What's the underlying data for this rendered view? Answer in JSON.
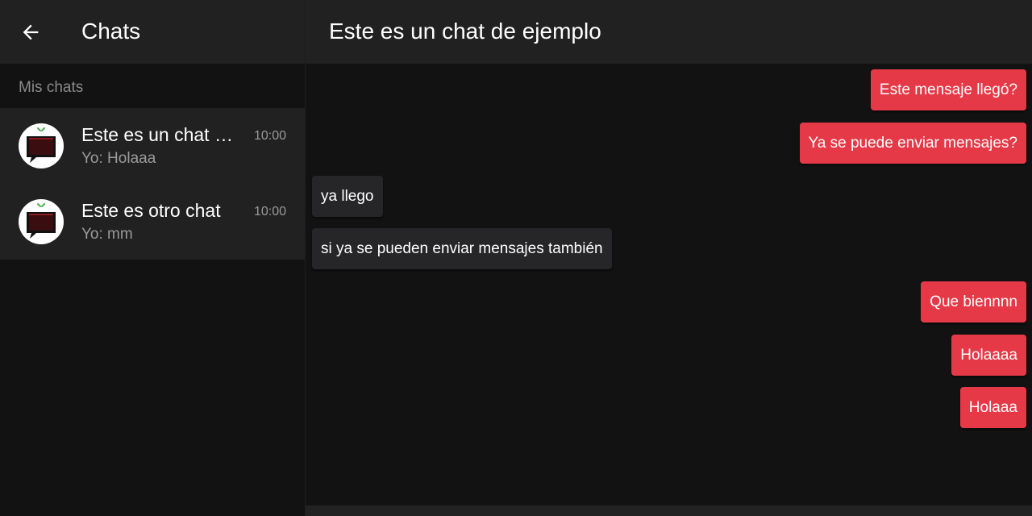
{
  "sidebar": {
    "title": "Chats",
    "section_label": "Mis chats",
    "chats": [
      {
        "name": "Este es un chat de ejemplo",
        "preview": "Yo: Holaaa",
        "time": "10:00"
      },
      {
        "name": "Este es otro chat",
        "preview": "Yo: mm",
        "time": "10:00"
      }
    ]
  },
  "main": {
    "title": "Este es un chat de ejemplo",
    "messages": [
      {
        "text": "Este mensaje llegó?",
        "direction": "sent"
      },
      {
        "text": "Ya se puede enviar mensajes?",
        "direction": "sent"
      },
      {
        "text": "ya llego",
        "direction": "received"
      },
      {
        "text": "si ya se pueden enviar mensajes también",
        "direction": "received"
      },
      {
        "text": "Que biennnn",
        "direction": "sent"
      },
      {
        "text": "Holaaaa",
        "direction": "sent"
      },
      {
        "text": "Holaaa",
        "direction": "sent"
      }
    ]
  },
  "icons": {
    "back": "arrow-left-icon",
    "avatar": "chat-bubble-logo-icon"
  },
  "colors": {
    "header_bg": "#212121",
    "page_bg": "#121212",
    "sent_bubble": "#e53947",
    "received_bubble": "#262629"
  }
}
